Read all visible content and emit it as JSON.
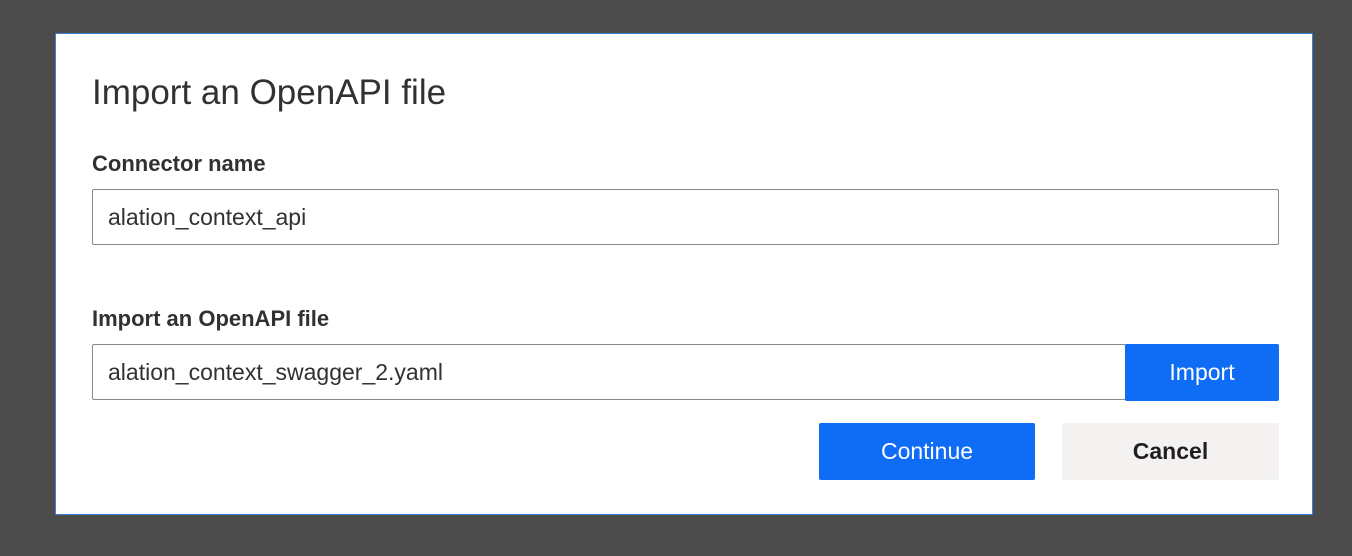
{
  "dialog": {
    "title": "Import an OpenAPI file",
    "connector_name": {
      "label": "Connector name",
      "value": "alation_context_api"
    },
    "openapi_file": {
      "label": "Import an OpenAPI file",
      "value": "alation_context_swagger_2.yaml",
      "import_label": "Import"
    },
    "actions": {
      "continue_label": "Continue",
      "cancel_label": "Cancel"
    }
  },
  "colors": {
    "backdrop": "#4b4b4b",
    "primary": "#0f6cf5",
    "secondary_button": "#f3f2f1",
    "dialog_border": "#3c7fd6"
  }
}
